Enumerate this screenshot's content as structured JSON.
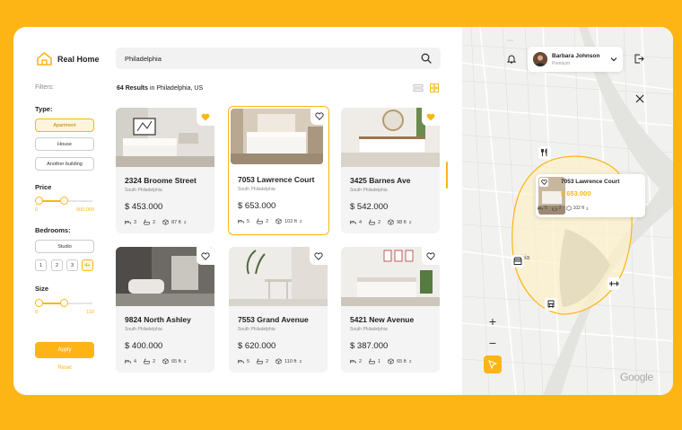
{
  "brand": {
    "name": "Real Home"
  },
  "filters": {
    "title": "Filters:",
    "type": {
      "label": "Type:",
      "options": [
        "Apartment",
        "House",
        "Another building"
      ],
      "selected": "Apartment"
    },
    "price": {
      "label": "Price",
      "min_label": "0",
      "max_label": "500.000",
      "range": [
        0.0,
        0.5
      ]
    },
    "bedrooms": {
      "label": "Bedrooms:",
      "studio": "Studio",
      "numbers": [
        "1",
        "2",
        "3",
        "4+"
      ],
      "selected": "4+"
    },
    "size": {
      "label": "Size",
      "min_label": "0",
      "max_label": "110",
      "range": [
        0.0,
        0.5
      ]
    },
    "apply": "Apply",
    "reset": "Reset"
  },
  "search": {
    "value": "Philadelphia",
    "icon": "search-icon"
  },
  "results": {
    "count": "64 Results",
    "location": " in Philadelphia, US"
  },
  "listings": [
    {
      "title": "2324 Broome Street",
      "area": "South Philadelphia",
      "price": "$ 453.000",
      "beds": "3",
      "baths": "2",
      "size": "87 ft",
      "favorite": true,
      "selected": false
    },
    {
      "title": "7053 Lawrence Court",
      "area": "South Philadelphia",
      "price": "$ 653.000",
      "beds": "5",
      "baths": "2",
      "size": "102 ft",
      "favorite": false,
      "selected": true
    },
    {
      "title": "3425 Barnes Ave",
      "area": "South Philadelphia",
      "price": "$ 542.000",
      "beds": "4",
      "baths": "2",
      "size": "98 ft",
      "favorite": true,
      "selected": false
    },
    {
      "title": "9824 North Ashley",
      "area": "South Philadelphia",
      "price": "$ 400.000",
      "beds": "4",
      "baths": "2",
      "size": "65 ft",
      "favorite": false,
      "selected": false
    },
    {
      "title": "7553 Grand Avenue",
      "area": "South Philadelphia",
      "price": "$ 620.000",
      "beds": "5",
      "baths": "2",
      "size": "110 ft",
      "favorite": false,
      "selected": false
    },
    {
      "title": "5421 New Avenue",
      "area": "South Philadelphia",
      "price": "$ 387.000",
      "beds": "2",
      "baths": "1",
      "size": "65 ft",
      "favorite": false,
      "selected": false
    }
  ],
  "size_exponent": "2",
  "user": {
    "name": "Barbara Johnson",
    "plan": "Premium"
  },
  "map": {
    "popup": {
      "title": "7053 Lawrence Court",
      "price": "$ 653.000",
      "beds": "5",
      "baths": "2",
      "size": "102 ft"
    },
    "zoom_in": "+",
    "zoom_out": "−",
    "attribution": "Google",
    "district_fragment": "phia"
  },
  "colors": {
    "accent": "#FDB515",
    "background": "#FDB515",
    "card": "#F4F4F4"
  }
}
